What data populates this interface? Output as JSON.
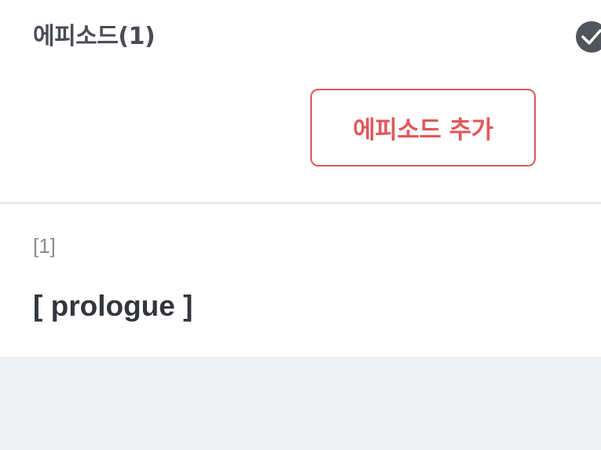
{
  "header": {
    "title": "에피소드(1)"
  },
  "actions": {
    "add_episode_label": "에피소드 추가"
  },
  "episodes": [
    {
      "number": "[1]",
      "title": "[ prologue ]"
    }
  ],
  "icons": {
    "check": "check-circle-icon"
  },
  "colors": {
    "accent": "#e0585b",
    "title_text": "#4a4d55",
    "muted_text": "#8a8d93",
    "background": "#f0f1f3",
    "check_bg": "#50545c"
  }
}
